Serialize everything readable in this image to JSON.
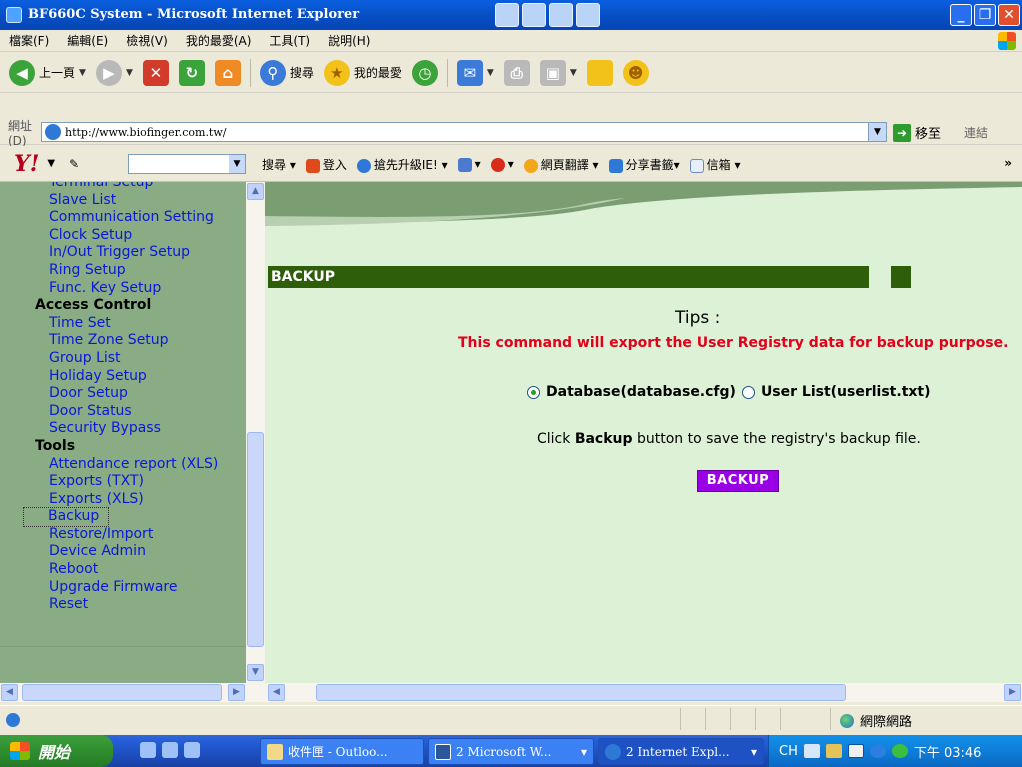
{
  "window": {
    "title": "BF660C System - Microsoft Internet Explorer"
  },
  "menu": [
    "檔案(F)",
    "編輯(E)",
    "檢視(V)",
    "我的最愛(A)",
    "工具(T)",
    "說明(H)"
  ],
  "toolbar": {
    "back_label": "上一頁",
    "search_label": "搜尋",
    "favorites_label": "我的最愛"
  },
  "address": {
    "label": "網址(D)",
    "url": "http://www.biofinger.com.tw/",
    "go_label": "移至",
    "links_label": "連結"
  },
  "yahoo_toolbar": {
    "search_label": "搜尋",
    "login_label": "登入",
    "upgrade_label": "搶先升級IE!",
    "translate_label": "網頁翻譯",
    "bookmarks_label": "分享書籤",
    "mail_label": "信箱"
  },
  "sidebar": {
    "items": [
      {
        "label": "Terminal Setup",
        "type": "link"
      },
      {
        "label": "Slave List",
        "type": "link"
      },
      {
        "label": "Communication Setting",
        "type": "link"
      },
      {
        "label": "Clock Setup",
        "type": "link"
      },
      {
        "label": "In/Out Trigger Setup",
        "type": "link"
      },
      {
        "label": "Ring Setup",
        "type": "link"
      },
      {
        "label": "Func. Key Setup",
        "type": "link"
      },
      {
        "label": "Access Control",
        "type": "head"
      },
      {
        "label": "Time Set",
        "type": "link"
      },
      {
        "label": "Time Zone Setup",
        "type": "link"
      },
      {
        "label": "Group List",
        "type": "link"
      },
      {
        "label": "Holiday Setup",
        "type": "link"
      },
      {
        "label": "Door Setup",
        "type": "link"
      },
      {
        "label": "Door Status",
        "type": "link"
      },
      {
        "label": "Security Bypass",
        "type": "link"
      },
      {
        "label": "Tools",
        "type": "head"
      },
      {
        "label": "Attendance report (XLS)",
        "type": "link"
      },
      {
        "label": "Exports (TXT)",
        "type": "link"
      },
      {
        "label": "Exports (XLS)",
        "type": "link"
      },
      {
        "label": "Backup",
        "type": "selected"
      },
      {
        "label": "Restore/Import",
        "type": "link"
      },
      {
        "label": "Device Admin",
        "type": "link"
      },
      {
        "label": "Reboot",
        "type": "link"
      },
      {
        "label": "Upgrade Firmware",
        "type": "link"
      },
      {
        "label": "Reset",
        "type": "link"
      }
    ]
  },
  "main": {
    "section_title": "BACKUP",
    "tips_heading": "Tips :",
    "tips_message": "This command will export the User Registry data for backup purpose.",
    "option_database": "Database(database.cfg)",
    "option_userlist": "User List(userlist.txt)",
    "selected_option": "database",
    "instruction_prefix": "Click",
    "instruction_bold": "Backup",
    "instruction_suffix": "button to save the registry's backup file.",
    "backup_button": "BACKUP"
  },
  "statusbar": {
    "zone": "網際網路"
  },
  "taskbar": {
    "start_label": "開始",
    "tasks": [
      "收件匣 - Outloo...",
      "2 Microsoft W...",
      "2 Internet Expl..."
    ],
    "tray_lang": "CH",
    "clock": "下午 03:46"
  },
  "colors": {
    "sidebar_bg": "#8aac84",
    "link": "#0a18d8",
    "section_bar": "#2f5e0a",
    "tips_message": "#e2001a",
    "backup_button": "#9a00e6",
    "main_bg": "#dcf1d6"
  }
}
